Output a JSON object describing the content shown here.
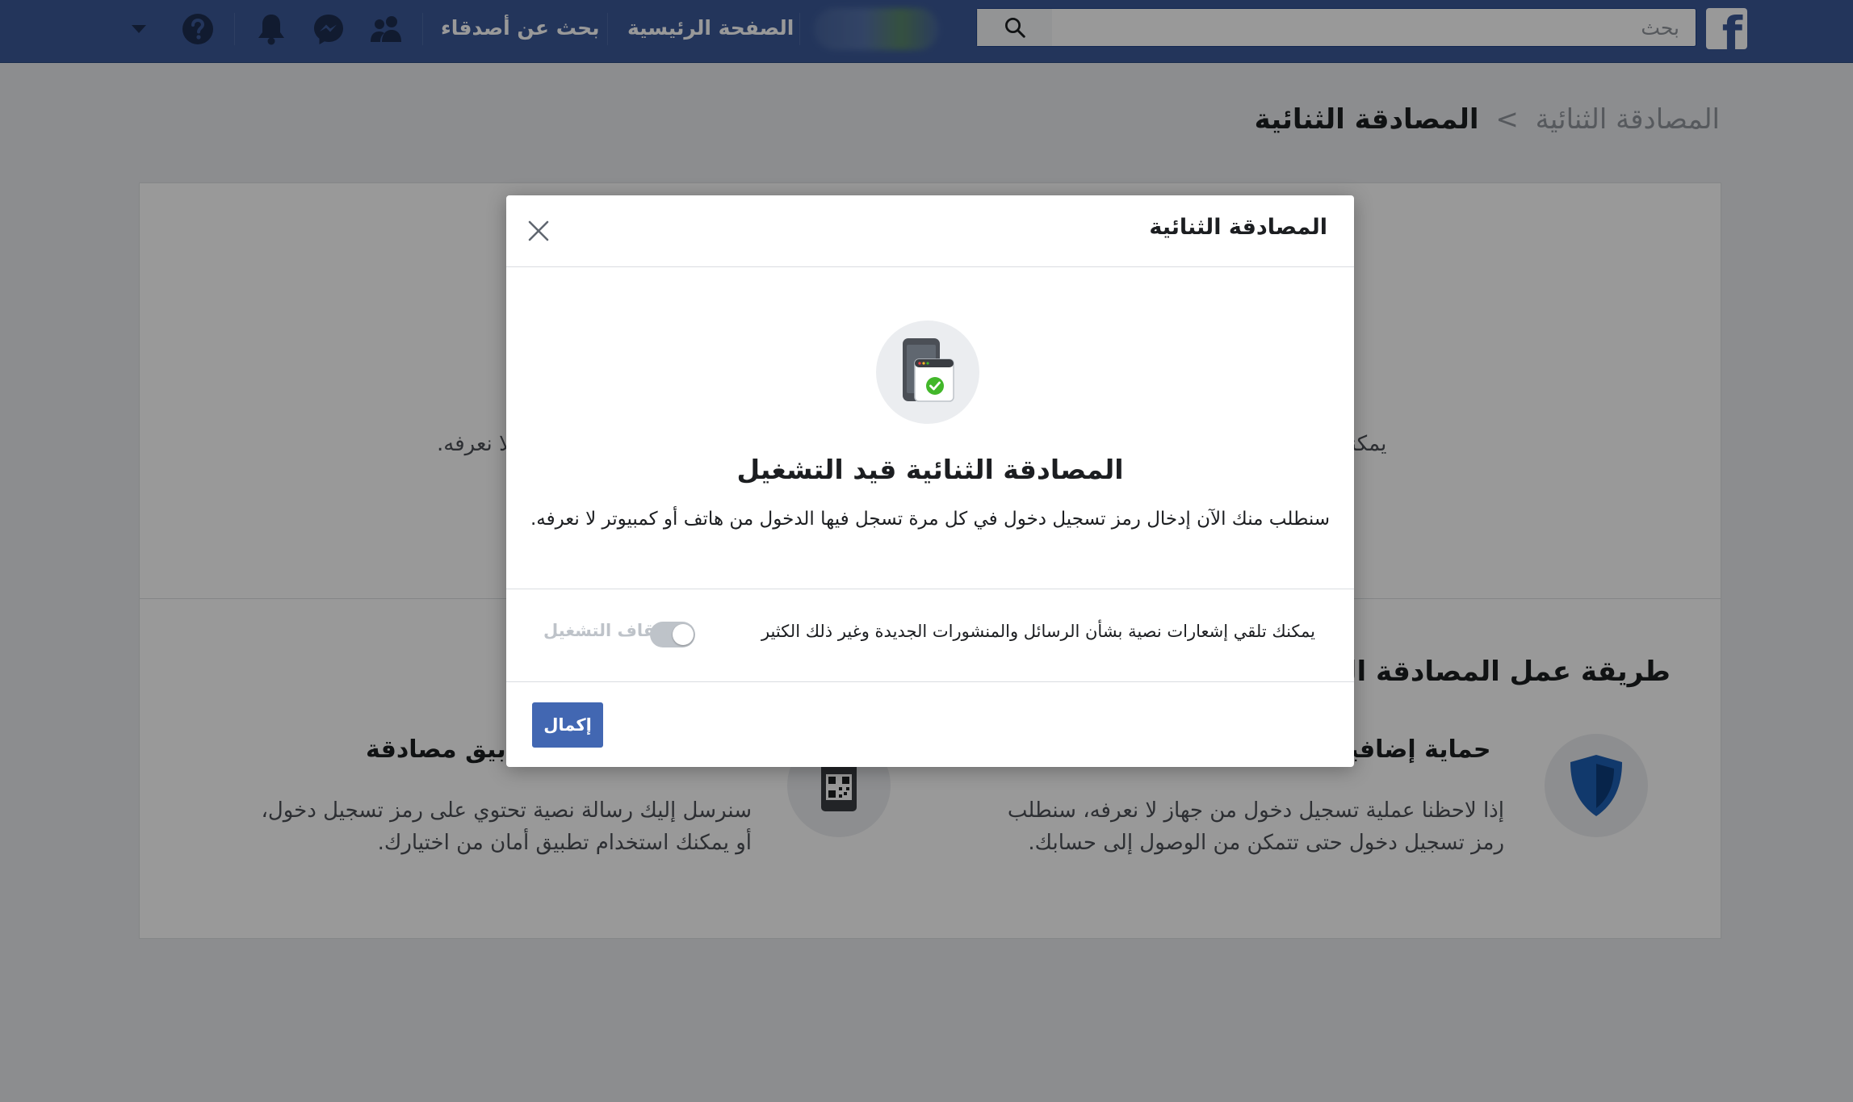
{
  "topbar": {
    "search_placeholder": "بحث",
    "nav_home": "الصفحة الرئيسية",
    "nav_find_friends": "بحث عن أصدقاء"
  },
  "breadcrumb": {
    "parent": "المصادقة الثنائية",
    "separator": ">",
    "current": "المصادقة الثنائية"
  },
  "background": {
    "intro_right": "يمكنك",
    "intro_left": "لا نعرفه.",
    "how_it_works_heading": "طريقة عمل المصادقة ال",
    "feature1_title": "حماية إضافية",
    "feature1_line1": "إذا لاحظنا عملية تسجيل دخول من جهاز لا نعرفه، سنطلب",
    "feature1_line2": "رمز تسجيل دخول حتى تتمكن من الوصول إلى حسابك.",
    "feature2_title": "بيق مصادقة",
    "feature2_line1": "سنرسل إليك رسالة نصية تحتوي على رمز تسجيل دخول،",
    "feature2_line2": "أو يمكنك استخدام تطبيق أمان من اختيارك."
  },
  "modal": {
    "title": "المصادقة الثنائية",
    "heading": "المصادقة الثنائية قيد التشغيل",
    "description": "سنطلب منك الآن إدخال رمز تسجيل دخول في كل مرة تسجل فيها الدخول من هاتف أو كمبيوتر لا نعرفه.",
    "sms_notifications_text": "يمكنك تلقي إشعارات نصية بشأن الرسائل والمنشورات الجديدة وغير ذلك الكثير",
    "toggle_label": "إيقاف التشغيل",
    "complete_button": "إكمال"
  },
  "colors": {
    "brand": "#3b5998",
    "button": "#4267b2",
    "success": "#42b72a",
    "shield": "#1d5fb5"
  }
}
